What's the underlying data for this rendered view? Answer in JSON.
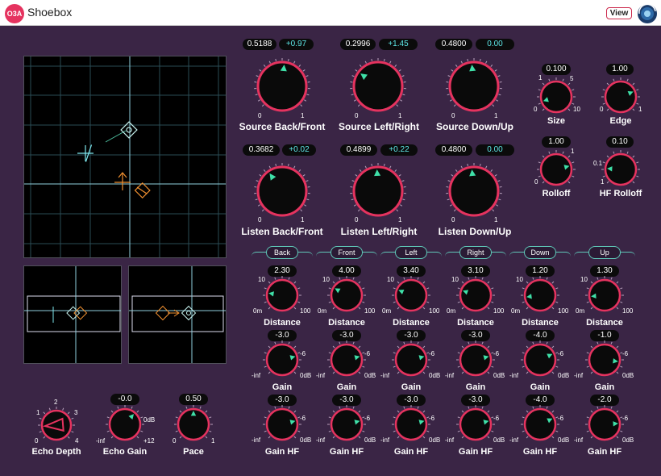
{
  "app": {
    "logo": "O3A",
    "title": "Shoebox",
    "view_label": "View"
  },
  "source": [
    {
      "key": "source-back-front",
      "label": "Source Back/Front",
      "value": "0.5188",
      "offset": "+0.97",
      "level": 0.52,
      "min": "0",
      "max": "1"
    },
    {
      "key": "source-left-right",
      "label": "Source Left/Right",
      "value": "0.2996",
      "offset": "+1.45",
      "level": 0.3,
      "min": "0",
      "max": "1"
    },
    {
      "key": "source-down-up",
      "label": "Source Down/Up",
      "value": "0.4800",
      "offset": "0.00",
      "level": 0.48,
      "min": "0",
      "max": "1"
    }
  ],
  "listen": [
    {
      "key": "listen-back-front",
      "label": "Listen Back/Front",
      "value": "0.3682",
      "offset": "+0.02",
      "level": 0.37,
      "min": "0",
      "max": "1"
    },
    {
      "key": "listen-left-right",
      "label": "Listen Left/Right",
      "value": "0.4899",
      "offset": "+0.22",
      "level": 0.49,
      "min": "0",
      "max": "1"
    },
    {
      "key": "listen-down-up",
      "label": "Listen Down/Up",
      "value": "0.4800",
      "offset": "0.00",
      "level": 0.48,
      "min": "0",
      "max": "1"
    }
  ],
  "room": [
    {
      "key": "size",
      "label": "Size",
      "value": "0.100",
      "level": 0.1,
      "ticks": [
        "0",
        "1",
        "5",
        "10"
      ]
    },
    {
      "key": "edge",
      "label": "Edge",
      "value": "1.00",
      "level": 0.75,
      "ticks": [
        "0",
        "1"
      ]
    },
    {
      "key": "rolloff",
      "label": "Rolloff",
      "value": "1.00",
      "level": 0.78,
      "ticks": [
        "0",
        "1"
      ]
    },
    {
      "key": "hf-rolloff",
      "label": "HF Rolloff",
      "value": "0.10",
      "level": 0.18,
      "ticks": [
        "0.1",
        "1"
      ]
    }
  ],
  "bands": [
    {
      "key": "back",
      "name": "Back",
      "distance": "2.30",
      "distance_level": 0.2,
      "gain": "-3.0",
      "gain_level": 0.78,
      "gain_hf": "-3.0",
      "gain_hf_level": 0.78
    },
    {
      "key": "front",
      "name": "Front",
      "distance": "4.00",
      "distance_level": 0.28,
      "gain": "-3.0",
      "gain_level": 0.78,
      "gain_hf": "-3.0",
      "gain_hf_level": 0.78
    },
    {
      "key": "left",
      "name": "Left",
      "distance": "3.40",
      "distance_level": 0.25,
      "gain": "-3.0",
      "gain_level": 0.78,
      "gain_hf": "-3.0",
      "gain_hf_level": 0.78
    },
    {
      "key": "right",
      "name": "Right",
      "distance": "3.10",
      "distance_level": 0.24,
      "gain": "-3.0",
      "gain_level": 0.78,
      "gain_hf": "-3.0",
      "gain_hf_level": 0.78
    },
    {
      "key": "down",
      "name": "Down",
      "distance": "1.20",
      "distance_level": 0.14,
      "gain": "-4.0",
      "gain_level": 0.74,
      "gain_hf": "-4.0",
      "gain_hf_level": 0.74
    },
    {
      "key": "up",
      "name": "Up",
      "distance": "1.30",
      "distance_level": 0.15,
      "gain": "-1.0",
      "gain_level": 0.86,
      "gain_hf": "-2.0",
      "gain_hf_level": 0.82
    }
  ],
  "band_ticks": {
    "distance": [
      "10",
      "0m",
      "100"
    ],
    "gain": [
      "-6",
      "-inf",
      "0dB"
    ]
  },
  "labels": {
    "distance": "Distance",
    "gain": "Gain",
    "gain_hf": "Gain HF"
  },
  "echo_depth": {
    "label": "Echo Depth",
    "level": 0.15,
    "ticks": [
      "0",
      "1",
      "2",
      "3",
      "4"
    ]
  },
  "echo_gain": {
    "label": "Echo Gain",
    "value": "-0.0",
    "level": 0.65,
    "ticks": [
      "-inf",
      "0dB",
      "+12"
    ]
  },
  "pace": {
    "label": "Pace",
    "value": "0.50",
    "level": 0.5,
    "ticks": [
      "0",
      "1"
    ]
  },
  "colors": {
    "accent": "#e5335f",
    "cyan": "#5ee8e8",
    "orange": "#f09030",
    "background": "#3a2545",
    "knob_body": "#0a0a0a"
  }
}
